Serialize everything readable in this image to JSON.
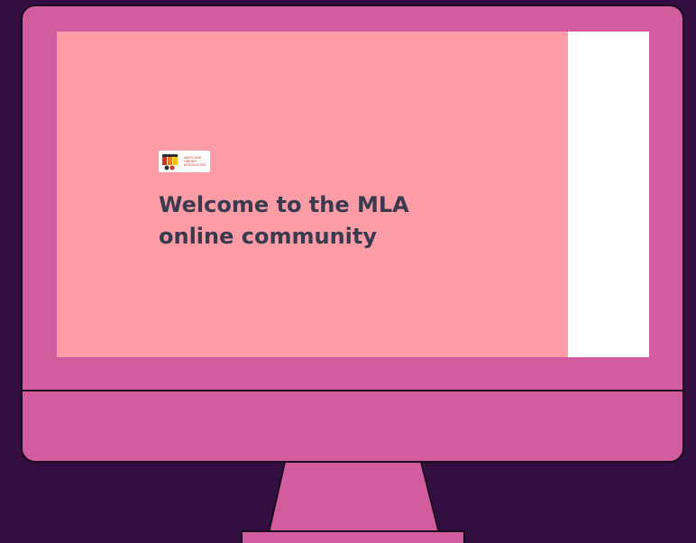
{
  "hero": {
    "title": "Welcome to the MLA online community"
  },
  "logo": {
    "lines": [
      "MARYLAND",
      "LIBRARY",
      "ASSOCIATION"
    ]
  },
  "colors": {
    "background": "#330e40",
    "monitor": "#d15d9f",
    "hero": "#fb9ca6",
    "title": "#3a3a4e",
    "logo_accent": "#c0392b"
  },
  "icons": {
    "logo": "mla-logo-icon"
  }
}
